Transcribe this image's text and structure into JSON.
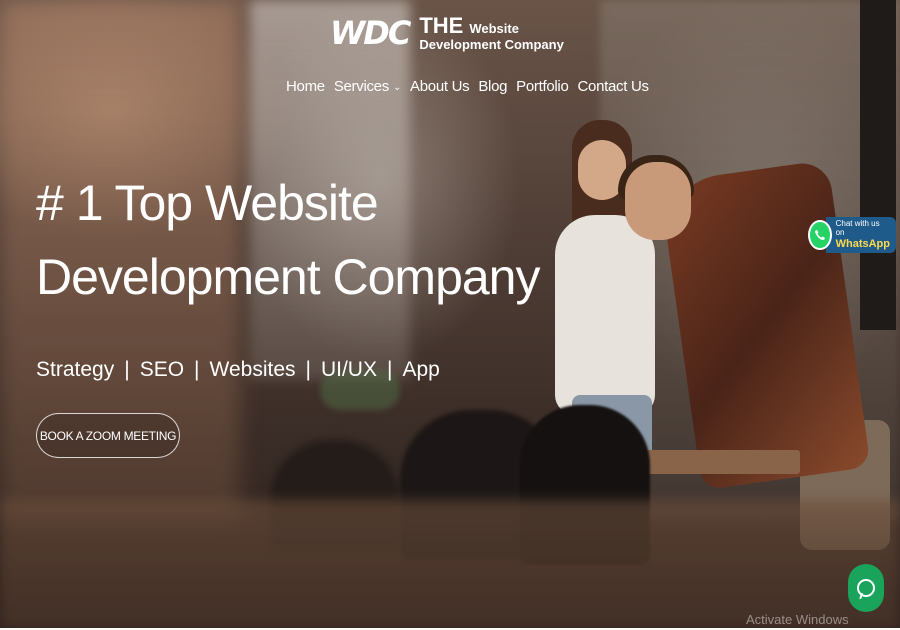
{
  "brand": {
    "mark": "WDC",
    "the": "THE",
    "website": "Website",
    "company": "Development Company"
  },
  "nav": {
    "items": [
      {
        "label": "Home"
      },
      {
        "label": "Services"
      },
      {
        "label": "About Us"
      },
      {
        "label": "Blog"
      },
      {
        "label": "Portfolio"
      },
      {
        "label": "Contact Us"
      }
    ]
  },
  "hero": {
    "headline_line1": "# 1 Top Website",
    "headline_line2": "Development Company",
    "services": [
      "Strategy",
      "SEO",
      "Websites",
      "UI/UX",
      "App"
    ],
    "separator": "|",
    "cta_label": "BOOK A ZOOM MEETING"
  },
  "whatsapp": {
    "small": "Chat with us on",
    "big": "WhatsApp"
  },
  "watermark": "Activate Windows",
  "icons": {
    "services_dropdown": "chevron-down-icon",
    "whatsapp": "whatsapp-icon",
    "chat": "chat-icon"
  },
  "colors": {
    "whatsapp_green": "#25d366",
    "chat_green": "#1aa35a",
    "whatsapp_label_bg": "#1f5b8a",
    "whatsapp_label_text": "#ffd94a"
  }
}
